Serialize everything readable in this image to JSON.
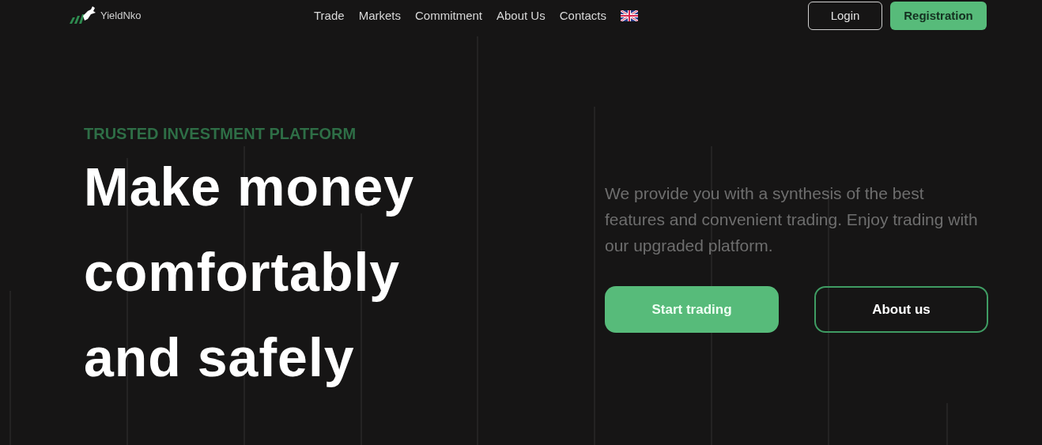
{
  "header": {
    "logo": "YieldNko",
    "nav": [
      {
        "label": "Trade"
      },
      {
        "label": "Markets"
      },
      {
        "label": "Commitment"
      },
      {
        "label": "About Us"
      },
      {
        "label": "Contacts"
      }
    ],
    "login": "Login",
    "register": "Registration"
  },
  "hero": {
    "eyebrow": "TRUSTED INVESTMENT PLATFORM",
    "headline": [
      "Make money",
      "comfortably",
      "and safely"
    ],
    "description": "We provide you with a synthesis of the best features and convenient trading. Enjoy trading with our upgraded platform.",
    "primary": "Start trading",
    "secondary": "About us"
  }
}
